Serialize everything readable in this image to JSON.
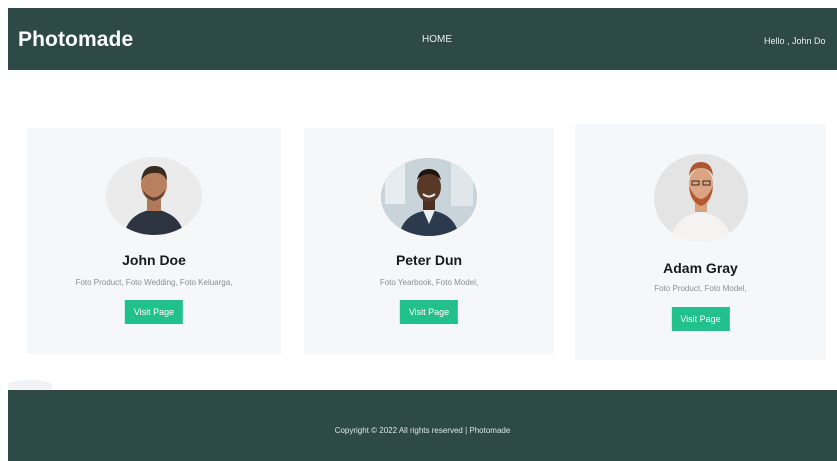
{
  "navbar": {
    "brand": "Photomade",
    "home_link": "HOME",
    "greeting": "Hello , John Do"
  },
  "cards": [
    {
      "name": "John Doe",
      "description": "Foto Product, Foto Wedding, Foto Keluarga,",
      "button_label": "Visit Page"
    },
    {
      "name": "Peter Dun",
      "description": "Foto Yearbook, Foto Model,",
      "button_label": "Visit Page"
    },
    {
      "name": "Adam Gray",
      "description": "Foto Product, Foto Model,",
      "button_label": "Visit Page"
    }
  ],
  "footer": {
    "copyright": "Copyright © 2022 All rights reserved | Photomade"
  },
  "colors": {
    "navbar_bg": "#2d4a47",
    "footer_bg": "#2d4a47",
    "button_bg": "#22c08a",
    "card_bg": "#f6f7f8"
  }
}
